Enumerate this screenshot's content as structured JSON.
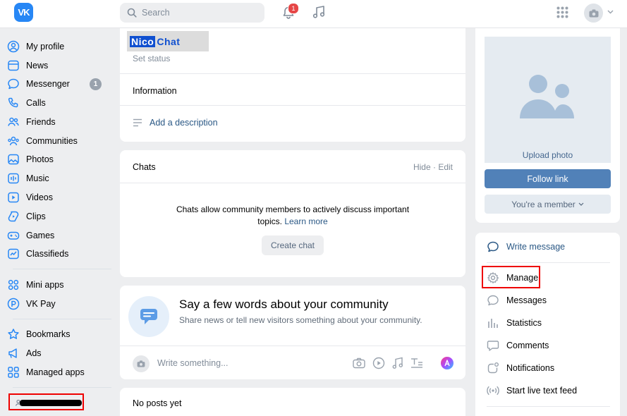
{
  "header": {
    "logo_text": "VK",
    "search_placeholder": "Search",
    "notifications_count": "1"
  },
  "sidebar": {
    "items": [
      {
        "label": "My profile",
        "icon": "user-circle-icon"
      },
      {
        "label": "News",
        "icon": "news-icon"
      },
      {
        "label": "Messenger",
        "icon": "message-icon",
        "badge": "1"
      },
      {
        "label": "Calls",
        "icon": "phone-icon"
      },
      {
        "label": "Friends",
        "icon": "friends-icon"
      },
      {
        "label": "Communities",
        "icon": "communities-icon"
      },
      {
        "label": "Photos",
        "icon": "photo-icon"
      },
      {
        "label": "Music",
        "icon": "music-icon"
      },
      {
        "label": "Videos",
        "icon": "video-icon"
      },
      {
        "label": "Clips",
        "icon": "clips-icon"
      },
      {
        "label": "Games",
        "icon": "gamepad-icon"
      },
      {
        "label": "Classifieds",
        "icon": "classifieds-icon"
      }
    ],
    "items2": [
      {
        "label": "Mini apps",
        "icon": "mini-apps-icon"
      },
      {
        "label": "VK Pay",
        "icon": "vkpay-icon"
      }
    ],
    "items3": [
      {
        "label": "Bookmarks",
        "icon": "star-icon"
      },
      {
        "label": "Ads",
        "icon": "megaphone-icon"
      },
      {
        "label": "Managed apps",
        "icon": "apps-icon"
      }
    ]
  },
  "community": {
    "name_part1": "Nico",
    "name_part2": "Chat",
    "set_status": "Set status",
    "information_title": "Information",
    "add_description": "Add a description"
  },
  "chats": {
    "title": "Chats",
    "hide": "Hide",
    "separator": " · ",
    "edit": "Edit",
    "text": "Chats allow community members to actively discuss important",
    "text2": "topics.",
    "learn_more": "Learn more",
    "create_button": "Create chat"
  },
  "composer": {
    "title": "Say a few words about your community",
    "subtitle": "Share news or tell new visitors something about your community.",
    "placeholder": "Write something..."
  },
  "wall": {
    "empty": "No posts yet"
  },
  "right_panel": {
    "upload_photo": "Upload photo",
    "follow_link": "Follow link",
    "member_status": "You're a member",
    "actions": [
      {
        "label": "Write message",
        "icon": "message-icon"
      },
      {
        "label": "Manage",
        "icon": "gear-icon"
      },
      {
        "label": "Messages",
        "icon": "message-icon"
      },
      {
        "label": "Statistics",
        "icon": "statistics-icon"
      },
      {
        "label": "Comments",
        "icon": "comment-icon"
      },
      {
        "label": "Notifications",
        "icon": "notification-icon"
      },
      {
        "label": "Start live text feed",
        "icon": "broadcast-icon"
      }
    ]
  },
  "colors": {
    "accent": "#5181b8",
    "link": "#2a5885",
    "highlight": "#e00000",
    "badge": "#e64646"
  }
}
